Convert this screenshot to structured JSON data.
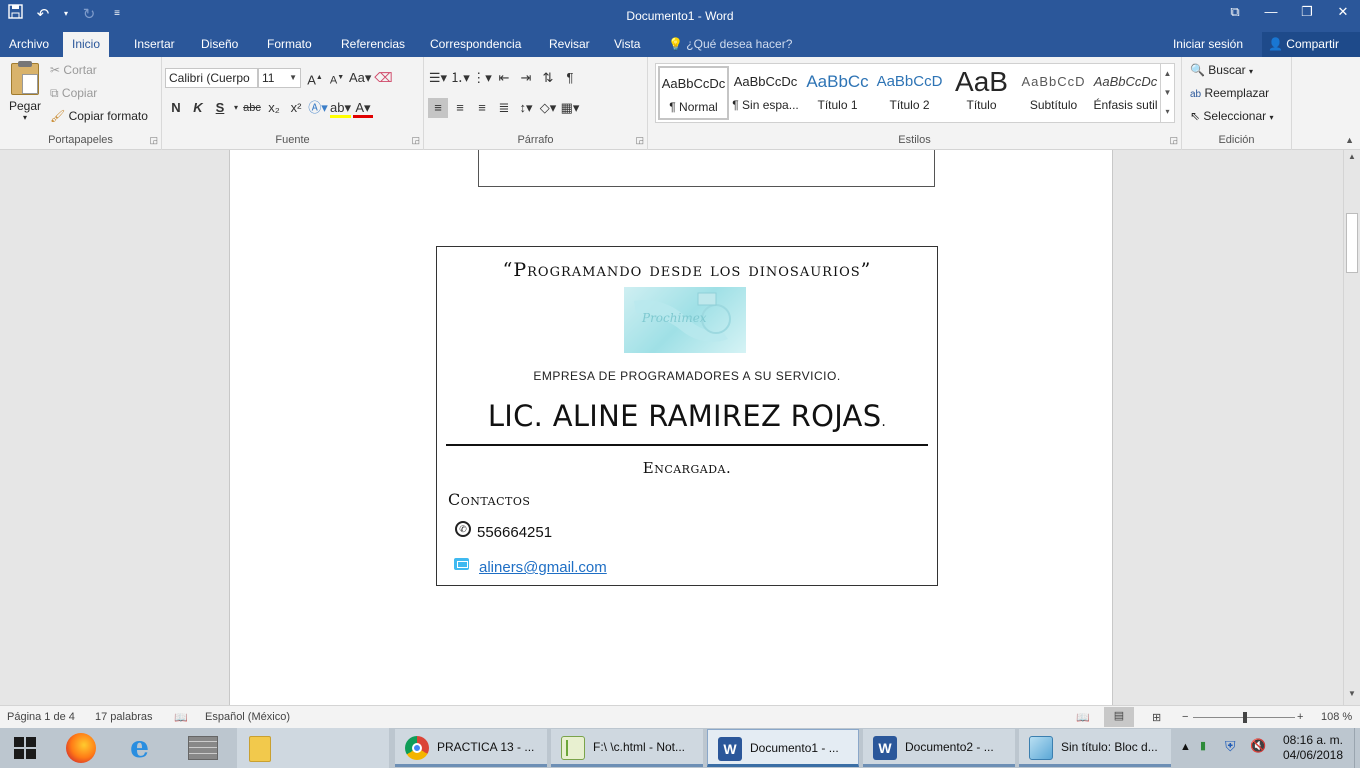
{
  "window": {
    "title": "Documento1 - Word"
  },
  "tabs": {
    "items": [
      "Archivo",
      "Inicio",
      "Insertar",
      "Diseño",
      "Formato",
      "Referencias",
      "Correspondencia",
      "Revisar",
      "Vista"
    ],
    "active": "Inicio",
    "tellme": "¿Qué desea hacer?",
    "signin": "Iniciar sesión",
    "share": "Compartir"
  },
  "ribbon": {
    "clipboard": {
      "paste": "Pegar",
      "cut": "Cortar",
      "copy": "Copiar",
      "format_painter": "Copiar formato",
      "label": "Portapapeles"
    },
    "font": {
      "family": "Calibri (Cuerpo",
      "size": "11",
      "bold": "N",
      "italic": "K",
      "underline": "S",
      "strike": "abc",
      "subscript": "x₂",
      "superscript": "x²",
      "case": "Aa",
      "label": "Fuente"
    },
    "paragraph": {
      "label": "Párrafo"
    },
    "styles": {
      "items": [
        {
          "preview": "AaBbCcDc",
          "name": "¶ Normal",
          "color": "#000000"
        },
        {
          "preview": "AaBbCcDc",
          "name": "¶ Sin espa...",
          "color": "#000000"
        },
        {
          "preview": "AaBbCc",
          "name": "Título 1",
          "color": "#2e74b5"
        },
        {
          "preview": "AaBbCcD",
          "name": "Título 2",
          "color": "#2e74b5"
        },
        {
          "preview": "AaB",
          "name": "Título",
          "color": "#000000"
        },
        {
          "preview": "AaBbCcD",
          "name": "Subtítulo",
          "color": "#595959"
        },
        {
          "preview": "AaBbCcDc",
          "name": "Énfasis sutil",
          "color": "#404040"
        }
      ],
      "label": "Estilos"
    },
    "editing": {
      "find": "Buscar",
      "replace": "Reemplazar",
      "select": "Seleccionar",
      "label": "Edición"
    }
  },
  "document": {
    "slogan": "“Programando desde los dinosaurios”",
    "logo_text": "Prochimex",
    "company": "EMPRESA DE PROGRAMADORES A SU SERVICIO.",
    "person": "LIC. ALINE RAMIREZ ROJAS",
    "person_suffix": ".",
    "role": "Encargada.",
    "contacts_heading": "Contactos",
    "phone": "556664251",
    "email": "aliners@gmail.com"
  },
  "statusbar": {
    "page": "Página 1 de 4",
    "words": "17 palabras",
    "language": "Español (México)",
    "zoom": "108 %"
  },
  "taskbar": {
    "apps": [
      {
        "label": "PRACTICA 13 - ...",
        "icon": "chrome-icon"
      },
      {
        "label": "F:\\ \\c.html - Not...",
        "icon": "notepadpp-icon"
      },
      {
        "label": "Documento1 - ...",
        "icon": "word-icon"
      },
      {
        "label": "Documento2 - ...",
        "icon": "word-icon"
      },
      {
        "label": "Sin título: Bloc d...",
        "icon": "notepad-icon"
      }
    ],
    "time": "08:16 a. m.",
    "date": "04/06/2018"
  }
}
